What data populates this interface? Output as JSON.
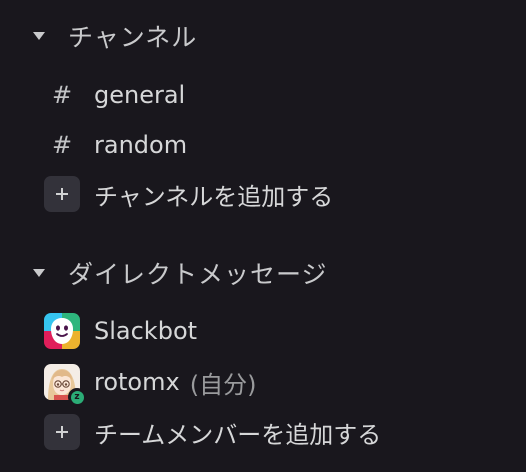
{
  "channels": {
    "title": "チャンネル",
    "items": [
      {
        "prefix": "#",
        "label": "general"
      },
      {
        "prefix": "#",
        "label": "random"
      }
    ],
    "add_label": "チャンネルを追加する"
  },
  "direct_messages": {
    "title": "ダイレクトメッセージ",
    "items": [
      {
        "label": "Slackbot",
        "avatar": "slackbot-avatar",
        "suffix": ""
      },
      {
        "label": "rotomx",
        "avatar": "user-avatar",
        "suffix": "(自分)",
        "status_badge": "z"
      }
    ],
    "add_label": "チームメンバーを追加する"
  },
  "colors": {
    "background": "#19171d",
    "text": "#d1d2d3",
    "button_bg": "#33323a",
    "presence_green": "#2bac76"
  }
}
